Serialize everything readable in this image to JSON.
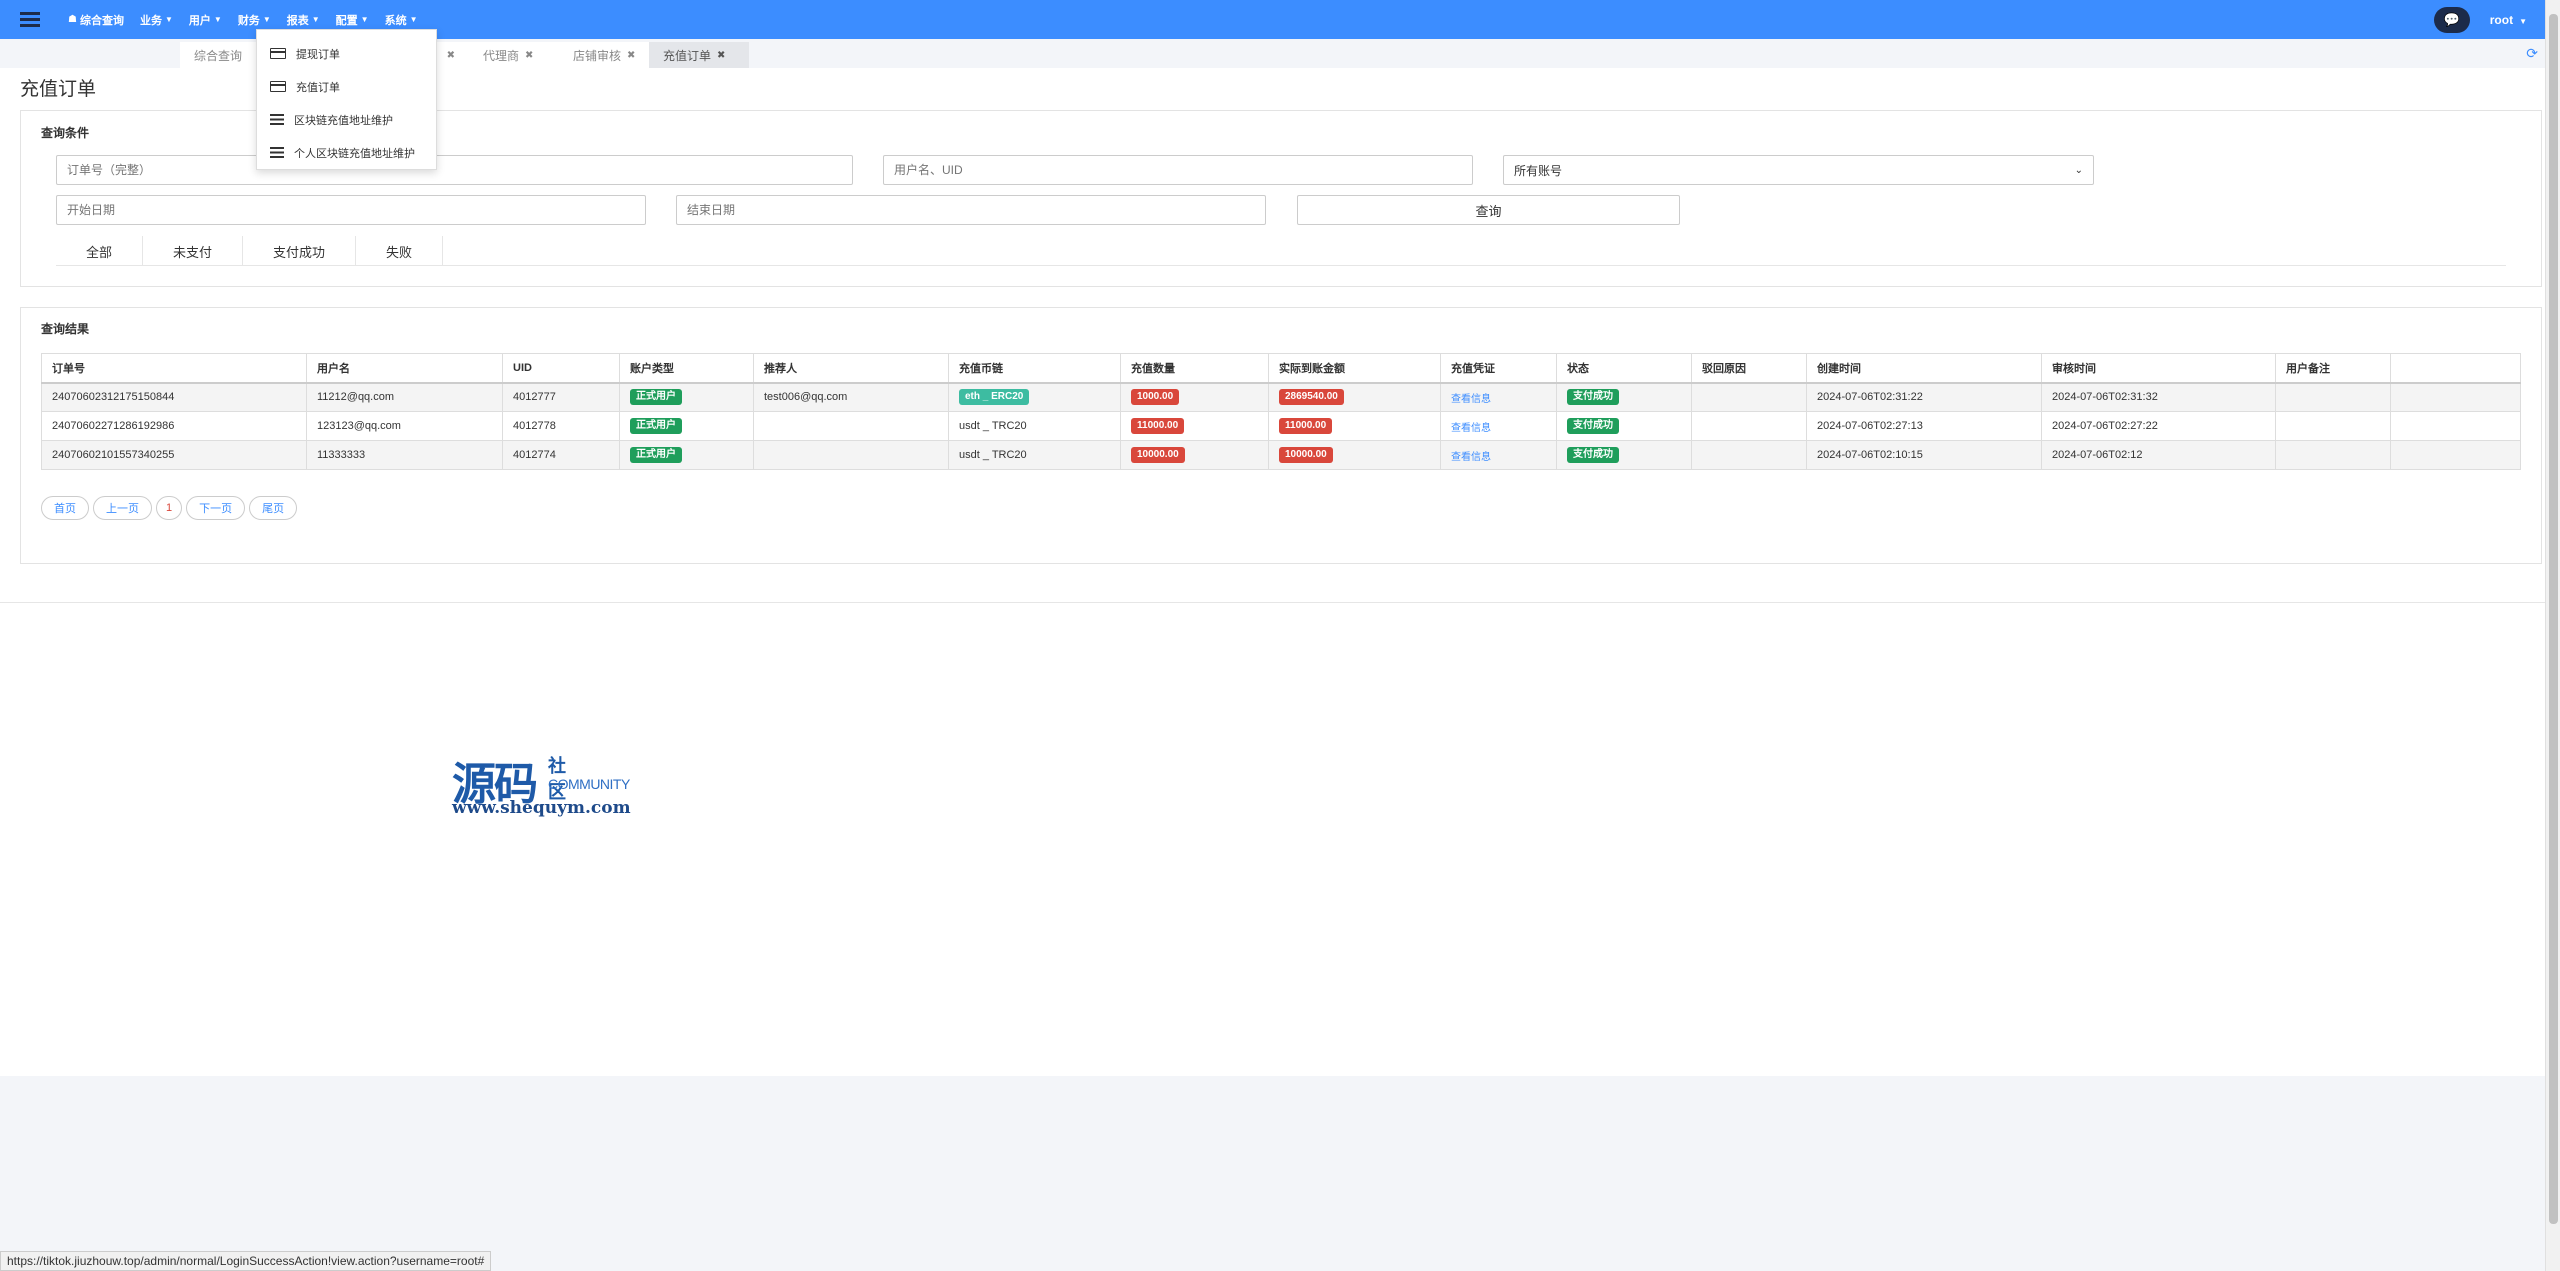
{
  "nav": {
    "home": "综合查询",
    "menus": [
      "业务",
      "用户",
      "财务",
      "报表",
      "配置",
      "系统"
    ]
  },
  "user": {
    "name": "root"
  },
  "tabs": [
    {
      "label": "综合查询"
    },
    {
      "label": "代理商"
    },
    {
      "label": "店铺审核"
    },
    {
      "label": "充值订单"
    }
  ],
  "dropdown": {
    "items": [
      {
        "label": "提现订单",
        "icon": "credit-card-icon"
      },
      {
        "label": "充值订单",
        "icon": "credit-card-icon"
      },
      {
        "label": "区块链充值地址维护",
        "icon": "list-icon"
      },
      {
        "label": "个人区块链充值地址维护",
        "icon": "list-icon"
      }
    ]
  },
  "page": {
    "title": "充值订单"
  },
  "filters": {
    "section_title": "查询条件",
    "order_no_placeholder": "订单号（完整）",
    "user_placeholder": "用户名、UID",
    "account_select": "所有账号",
    "start_placeholder": "开始日期",
    "end_placeholder": "结束日期",
    "query_label": "查询",
    "status_tabs": [
      "全部",
      "未支付",
      "支付成功",
      "失败"
    ]
  },
  "results": {
    "section_title": "查询结果",
    "columns": [
      "订单号",
      "用户名",
      "UID",
      "账户类型",
      "推荐人",
      "充值币链",
      "充值数量",
      "实际到账金额",
      "充值凭证",
      "状态",
      "驳回原因",
      "创建时间",
      "审核时间",
      "用户备注",
      ""
    ],
    "rows": [
      {
        "order_no": "24070602312175150844",
        "username": "11212@qq.com",
        "uid": "4012777",
        "account_type": "正式用户",
        "referrer": "test006@qq.com",
        "chain": "eth _ ERC20",
        "amount": "1000.00",
        "actual": "2869540.00",
        "voucher": "查看信息",
        "status": "支付成功",
        "reject": "",
        "created": "2024-07-06T02:31:22",
        "audited": "2024-07-06T02:31:32",
        "remark": ""
      },
      {
        "order_no": "24070602271286192986",
        "username": "123123@qq.com",
        "uid": "4012778",
        "account_type": "正式用户",
        "referrer": "",
        "chain": "usdt _ TRC20",
        "amount": "11000.00",
        "actual": "11000.00",
        "voucher": "查看信息",
        "status": "支付成功",
        "reject": "",
        "created": "2024-07-06T02:27:13",
        "audited": "2024-07-06T02:27:22",
        "remark": ""
      },
      {
        "order_no": "24070602101557340255",
        "username": "11333333",
        "uid": "4012774",
        "account_type": "正式用户",
        "referrer": "",
        "chain": "usdt _ TRC20",
        "amount": "10000.00",
        "actual": "10000.00",
        "voucher": "查看信息",
        "status": "支付成功",
        "reject": "",
        "created": "2024-07-06T02:10:15",
        "audited": "2024-07-06T02:12",
        "remark": ""
      }
    ]
  },
  "pager": {
    "first": "首页",
    "prev": "上一页",
    "current": "1",
    "next": "下一页",
    "last": "尾页"
  },
  "watermark": {
    "cn": "源码",
    "small": "社区",
    "en": "COMMUNITY",
    "url": "www.shequym.com"
  },
  "status_url": "https://tiktok.jiuzhouw.top/admin/normal/LoginSuccessAction!view.action?username=root#",
  "colors": {
    "primary": "#3c8dff",
    "success": "#1f9e5b",
    "danger": "#d9473b",
    "info": "#3dbca1"
  }
}
